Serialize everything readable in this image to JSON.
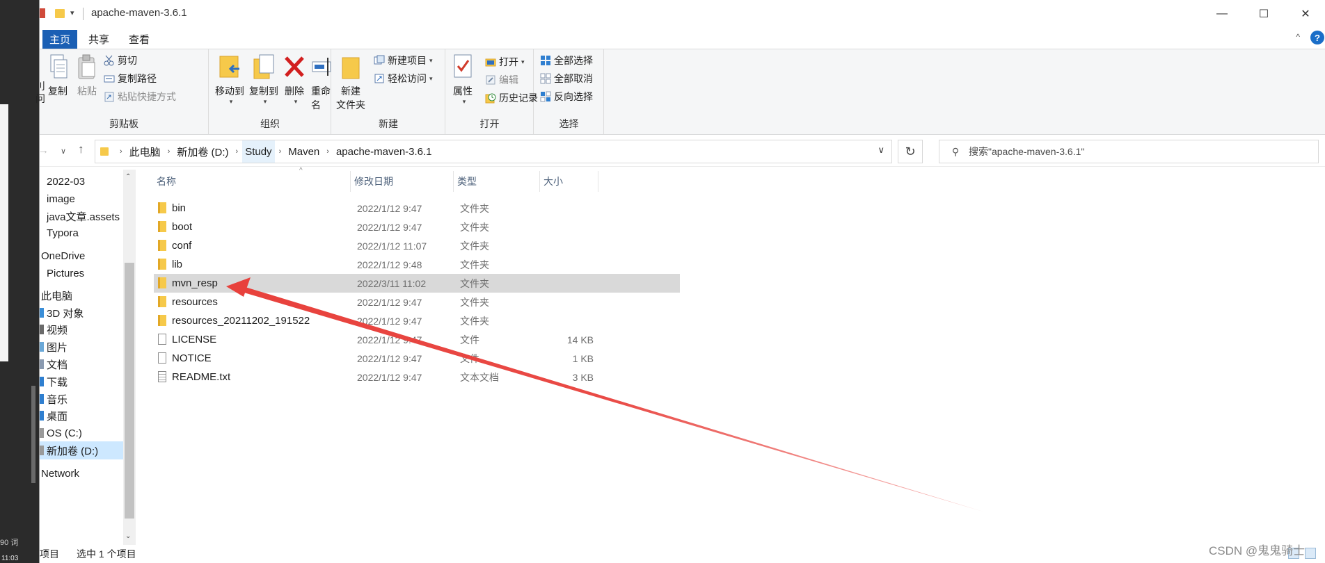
{
  "window": {
    "title": "apache-maven-3.6.1",
    "quick_access_dropdown": "▾",
    "controls": {
      "minimize": "—",
      "maximize": "☐",
      "close": "✕"
    }
  },
  "ribbon_tabs": [
    {
      "label": "主页",
      "active": true
    },
    {
      "label": "共享",
      "active": false
    },
    {
      "label": "查看",
      "active": false
    }
  ],
  "ribbon_collapse": "^",
  "help_glyph": "?",
  "ribbon": {
    "clipboard": {
      "label": "剪贴板",
      "cut_partial": "刂\n问",
      "copy": "复制",
      "paste": "粘贴",
      "cut": "剪切",
      "copy_path": "复制路径",
      "paste_shortcut": "粘贴快捷方式"
    },
    "organize": {
      "label": "组织",
      "move_to": "移动到",
      "copy_to": "复制到",
      "delete": "删除",
      "rename": "重命名"
    },
    "new": {
      "label": "新建",
      "new_folder_line1": "新建",
      "new_folder_line2": "文件夹",
      "new_item": "新建项目",
      "easy_access": "轻松访问"
    },
    "open": {
      "label": "打开",
      "properties": "属性",
      "open": "打开",
      "edit": "编辑",
      "history": "历史记录"
    },
    "select": {
      "label": "选择",
      "select_all": "全部选择",
      "select_none": "全部取消",
      "invert": "反向选择"
    }
  },
  "address": {
    "breadcrumbs": [
      "此电脑",
      "新加卷 (D:)",
      "Study",
      "Maven",
      "apache-maven-3.6.1"
    ],
    "search_placeholder": "搜索\"apache-maven-3.6.1\""
  },
  "nav_pane": [
    {
      "label": "2022-03"
    },
    {
      "label": "image"
    },
    {
      "label": "java文章.assets"
    },
    {
      "label": "Typora"
    },
    {
      "label": "OneDrive"
    },
    {
      "label": "Pictures"
    },
    {
      "label": "此电脑"
    },
    {
      "label": "3D 对象"
    },
    {
      "label": "视频"
    },
    {
      "label": "图片"
    },
    {
      "label": "文档"
    },
    {
      "label": "下载"
    },
    {
      "label": "音乐"
    },
    {
      "label": "桌面"
    },
    {
      "label": "OS (C:)"
    },
    {
      "label": "新加卷 (D:)"
    },
    {
      "label": "Network"
    }
  ],
  "file_list": {
    "columns": {
      "name": "名称",
      "modified": "修改日期",
      "type": "类型",
      "size": "大小"
    },
    "rows": [
      {
        "name": "bin",
        "modified": "2022/1/12 9:47",
        "type": "文件夹",
        "size": "",
        "icon": "folder-icon"
      },
      {
        "name": "boot",
        "modified": "2022/1/12 9:47",
        "type": "文件夹",
        "size": "",
        "icon": "folder-icon"
      },
      {
        "name": "conf",
        "modified": "2022/1/12 11:07",
        "type": "文件夹",
        "size": "",
        "icon": "folder-icon"
      },
      {
        "name": "lib",
        "modified": "2022/1/12 9:48",
        "type": "文件夹",
        "size": "",
        "icon": "folder-icon"
      },
      {
        "name": "mvn_resp",
        "modified": "2022/3/11 11:02",
        "type": "文件夹",
        "size": "",
        "icon": "folder-icon",
        "selected": true
      },
      {
        "name": "resources",
        "modified": "2022/1/12 9:47",
        "type": "文件夹",
        "size": "",
        "icon": "folder-icon"
      },
      {
        "name": "resources_20211202_191522",
        "modified": "2022/1/12 9:47",
        "type": "文件夹",
        "size": "",
        "icon": "folder-icon"
      },
      {
        "name": "LICENSE",
        "modified": "2022/1/12 9:47",
        "type": "文件",
        "size": "14 KB",
        "icon": "file-icon"
      },
      {
        "name": "NOTICE",
        "modified": "2022/1/12 9:47",
        "type": "文件",
        "size": "1 KB",
        "icon": "file-icon"
      },
      {
        "name": "README.txt",
        "modified": "2022/1/12 9:47",
        "type": "文本文档",
        "size": "3 KB",
        "icon": "text-file-icon"
      }
    ]
  },
  "status": {
    "item_count_partial": "项目",
    "selection": "选中 1 个项目"
  },
  "background_window": {
    "word_count_partial": "90 词",
    "clock_partial": "11:03"
  },
  "watermark": "CSDN @鬼鬼骑士",
  "annotation": {
    "color": "#e8413c",
    "points_to": "mvn_resp"
  }
}
